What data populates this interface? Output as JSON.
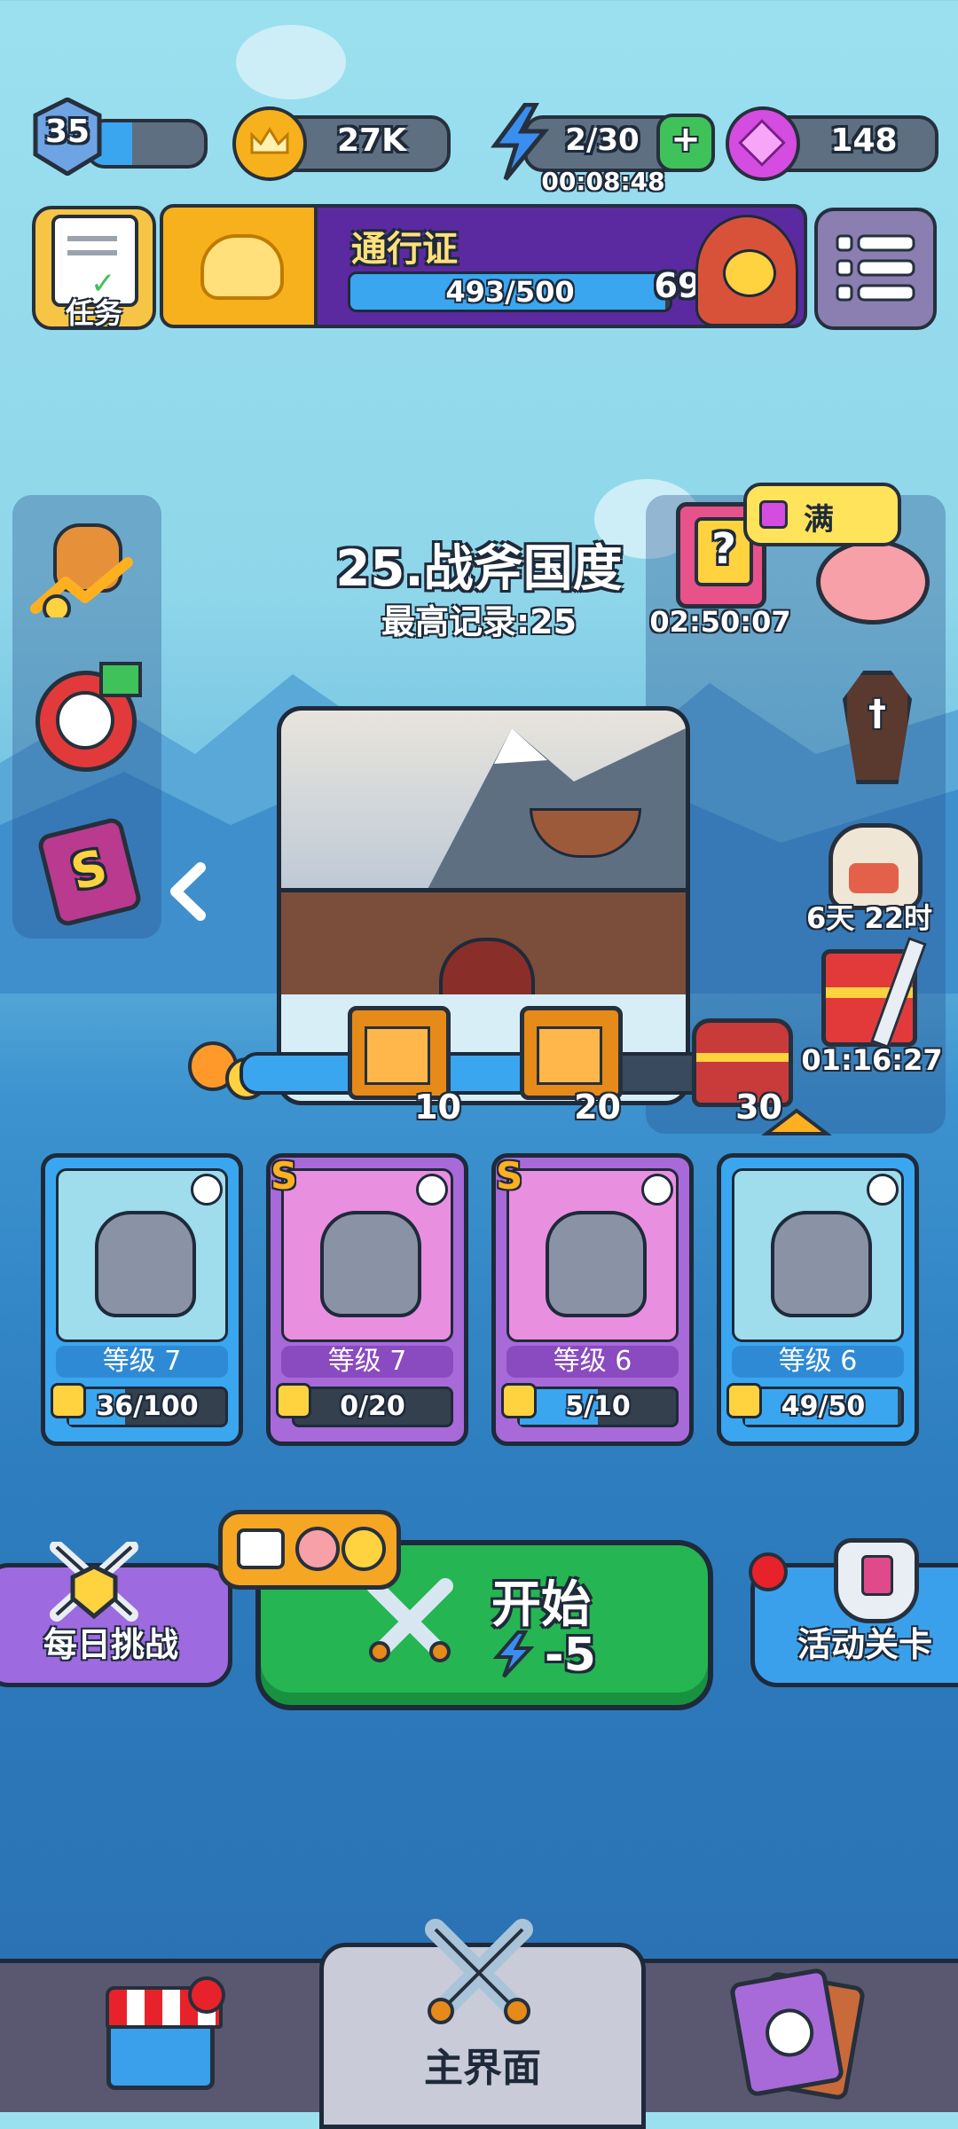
{
  "colors": {
    "sky": "#9be0ef",
    "sea": "#2d7dbf",
    "start_green": "#25b552",
    "purple": "#9d6ae0",
    "blue_card": "#3aa6f0",
    "gold": "#f6b11d"
  },
  "top_bar": {
    "level": "35",
    "xp_fraction": 0.38,
    "coins": "27K",
    "energy": "2/30",
    "energy_timer": "00:08:48",
    "gems": "148"
  },
  "quest_button": {
    "label": "任务"
  },
  "battle_pass": {
    "title": "通行证",
    "progress": "493/500",
    "progress_fraction": 0.986,
    "level": "69"
  },
  "stage": {
    "title": "25.战斧国度",
    "best_record": "最高记录:25"
  },
  "right_panel": {
    "mystery_timer": "02:50:07",
    "piggy_bubble": "满",
    "event_days": "6天 22时",
    "chest_timer": "01:16:27"
  },
  "milestones": [
    {
      "label": "10"
    },
    {
      "label": "20"
    },
    {
      "label": "30"
    }
  ],
  "milestone_progress_fraction": 0.62,
  "hero_cards": [
    {
      "rank": "",
      "level": "等级 7",
      "fragments": "36/100",
      "frag_fraction": 0.36,
      "frame": "#3aa6f0",
      "bg": "#9fdcec",
      "icon": "potion-icon"
    },
    {
      "rank": "S",
      "level": "等级 7",
      "fragments": "0/20",
      "frag_fraction": 0.0,
      "frame": "#a86ad8",
      "bg": "#e98fe0",
      "icon": "bat-icon"
    },
    {
      "rank": "S",
      "level": "等级 6",
      "fragments": "5/10",
      "frag_fraction": 0.5,
      "frame": "#a86ad8",
      "bg": "#e98fe0",
      "icon": "water-drop-icon"
    },
    {
      "rank": "",
      "level": "等级 6",
      "fragments": "49/50",
      "frag_fraction": 0.98,
      "frame": "#3aa6f0",
      "bg": "#9fdcec",
      "icon": "potion-icon"
    }
  ],
  "actions": {
    "daily_challenge": "每日挑战",
    "start": "开始",
    "start_cost": "-5",
    "event_stage": "活动关卡"
  },
  "bottom_nav": {
    "main": "主界面"
  }
}
